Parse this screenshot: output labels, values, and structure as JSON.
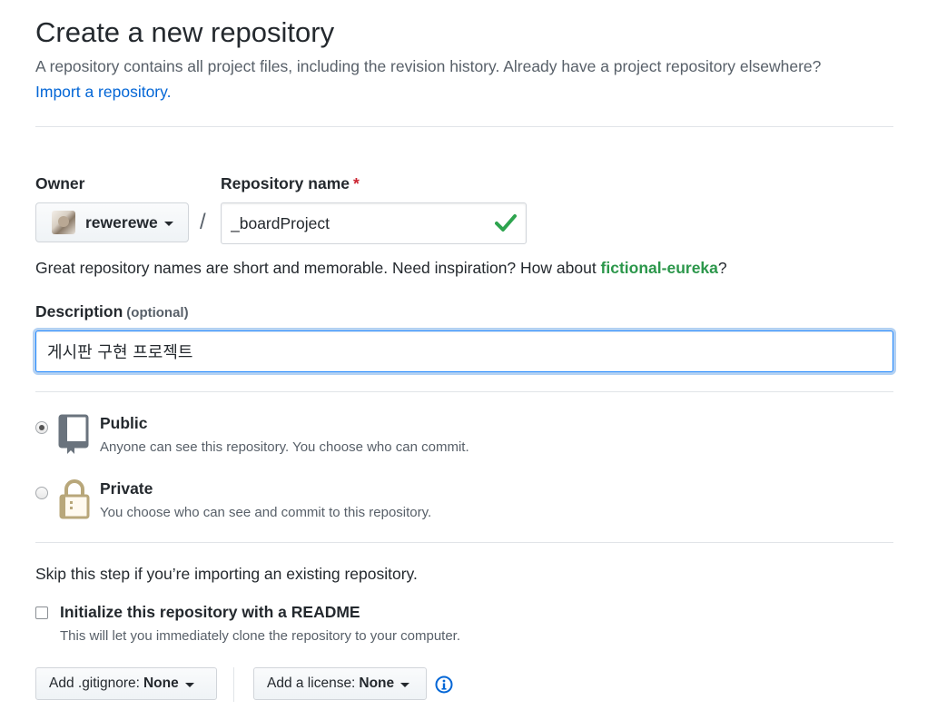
{
  "header": {
    "title": "Create a new repository",
    "subtitle": "A repository contains all project files, including the revision history. Already have a project repository elsewhere?",
    "import_link": "Import a repository."
  },
  "owner": {
    "label": "Owner",
    "name": "rewerewe"
  },
  "separator_slash": "/",
  "repo": {
    "label": "Repository name",
    "required_mark": "*",
    "value": "_boardProject"
  },
  "hint": {
    "text": "Great repository names are short and memorable. Need inspiration? How about ",
    "suggestion": "fictional-eureka",
    "suffix": "?"
  },
  "description": {
    "label": "Description",
    "optional": "(optional)",
    "value": "게시판 구현 프로젝트"
  },
  "visibility": {
    "public": {
      "title": "Public",
      "desc": "Anyone can see this repository. You choose who can commit.",
      "checked": true
    },
    "private": {
      "title": "Private",
      "desc": "You choose who can see and commit to this repository.",
      "checked": false
    }
  },
  "init": {
    "skip_text": "Skip this step if you’re importing an existing repository.",
    "readme_label": "Initialize this repository with a README",
    "readme_desc": "This will let you immediately clone the repository to your computer.",
    "readme_checked": false
  },
  "dropdowns": {
    "gitignore_label": "Add .gitignore:",
    "gitignore_value": "None",
    "license_label": "Add a license:",
    "license_value": "None"
  },
  "colors": {
    "link": "#0366d6",
    "success": "#2c974b",
    "required": "#cb2431",
    "focus": "#2188ff"
  }
}
